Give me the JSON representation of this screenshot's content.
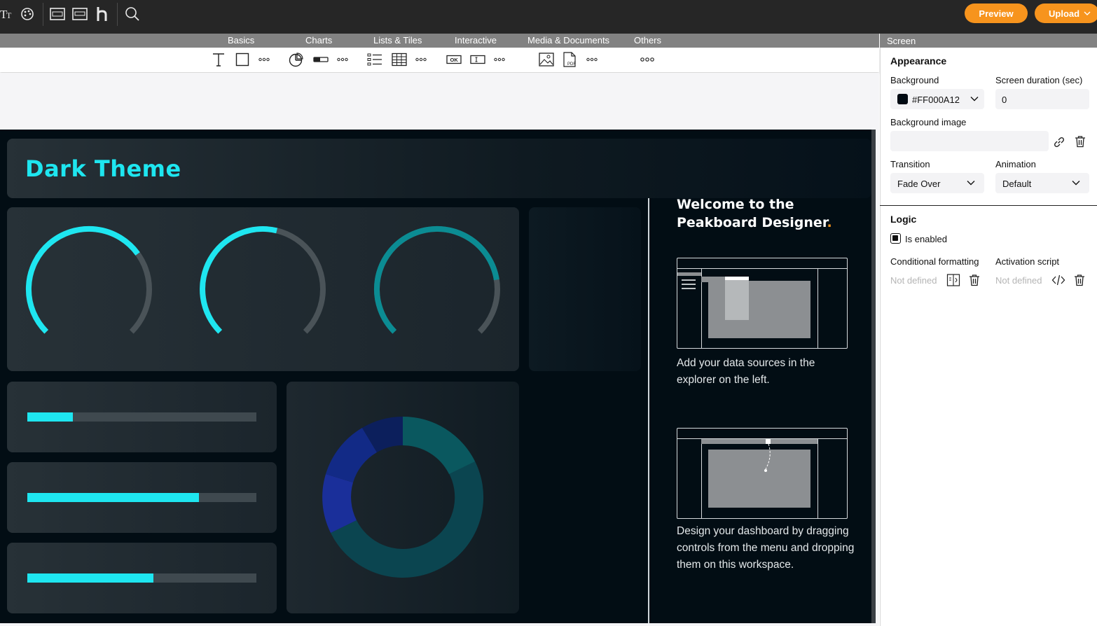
{
  "topbar": {
    "icons": [
      "text-style-icon",
      "palette-icon",
      "peakboard-box-icon",
      "edge-icon",
      "hub-icon",
      "search-icon"
    ],
    "preview_label": "Preview",
    "upload_label": "Upload",
    "accent": "#f7941d"
  },
  "categories": [
    "Basics",
    "Charts",
    "Lists & Tiles",
    "Interactive",
    "Media & Documents",
    "Others"
  ],
  "tools": [
    "text-tool-icon",
    "rectangle-tool-icon",
    "more-basics-icon",
    "pie-chart-tool-icon",
    "bar-tool-icon",
    "more-charts-icon",
    "list-tool-icon",
    "table-tool-icon",
    "more-lists-icon",
    "button-tool-icon",
    "textbox-tool-icon",
    "more-interactive-icon",
    "image-tool-icon",
    "pdf-tool-icon",
    "more-media-icon",
    "more-others-icon"
  ],
  "canvas": {
    "title": "Dark Theme",
    "title_color": "#1ee6f0",
    "welcome_line1": "Welcome to the",
    "welcome_line2": "Peakboard Designer",
    "welcome_dot": ".",
    "step1": "Add your data sources in the explorer on the left.",
    "step2": "Design your dashboard by dragging controls from the menu and dropping them on this workspace.",
    "gauges": [
      0.7,
      0.55,
      0.8
    ],
    "bars": [
      0.2,
      0.75,
      0.55
    ],
    "donut_colors": [
      "#0a4f55",
      "#0c3e52",
      "#0f2a6e",
      "#152a8c"
    ]
  },
  "panel": {
    "header": "Screen",
    "appearance_title": "Appearance",
    "background_label": "Background",
    "background_value": "#FF000A12",
    "duration_label": "Screen duration (sec)",
    "duration_value": "0",
    "bgimage_label": "Background image",
    "transition_label": "Transition",
    "transition_value": "Fade Over",
    "animation_label": "Animation",
    "animation_value": "Default",
    "logic_title": "Logic",
    "enabled_label": "Is enabled",
    "condfmt_label": "Conditional formatting",
    "condfmt_value": "Not defined",
    "activation_label": "Activation script",
    "activation_value": "Not defined"
  }
}
